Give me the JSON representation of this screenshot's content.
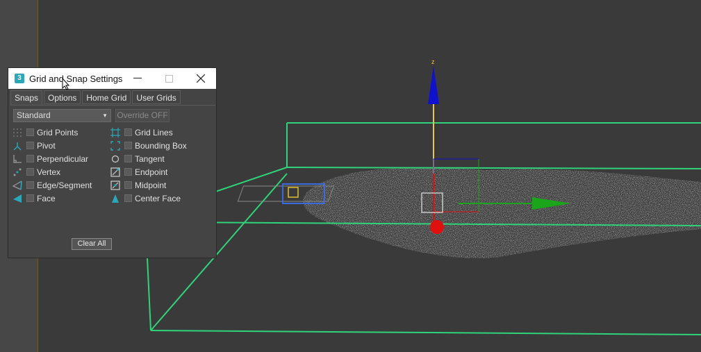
{
  "dialog": {
    "app_icon": "3",
    "title": "Grid and Snap Settings",
    "tabs": [
      "Snaps",
      "Options",
      "Home Grid",
      "User Grids"
    ],
    "active_tab": "Snaps",
    "dropdown_value": "Standard",
    "override_label": "Override OFF",
    "snaps_left": [
      {
        "label": "Grid Points",
        "icon": "grid-points-icon",
        "checked": false
      },
      {
        "label": "Pivot",
        "icon": "pivot-icon",
        "checked": false
      },
      {
        "label": "Perpendicular",
        "icon": "perpendicular-icon",
        "checked": false
      },
      {
        "label": "Vertex",
        "icon": "vertex-icon",
        "checked": false
      },
      {
        "label": "Edge/Segment",
        "icon": "edge-segment-icon",
        "checked": false
      },
      {
        "label": "Face",
        "icon": "face-icon",
        "checked": false
      }
    ],
    "snaps_right": [
      {
        "label": "Grid Lines",
        "icon": "grid-lines-icon",
        "checked": false
      },
      {
        "label": "Bounding Box",
        "icon": "bounding-box-icon",
        "checked": false
      },
      {
        "label": "Tangent",
        "icon": "tangent-icon",
        "checked": false
      },
      {
        "label": "Endpoint",
        "icon": "endpoint-icon",
        "checked": false
      },
      {
        "label": "Midpoint",
        "icon": "midpoint-icon",
        "checked": false
      },
      {
        "label": "Center Face",
        "icon": "center-face-icon",
        "checked": false
      }
    ],
    "clear_all_label": "Clear All"
  },
  "viewport": {
    "gizmo_z_label": "z",
    "colors": {
      "background": "#3a3a3a",
      "selection_box": "#2fd47a",
      "axis_x": "#1aa51a",
      "axis_y": "#e01010",
      "axis_z": "#1010d0",
      "accent": "#2aa8b8"
    }
  }
}
